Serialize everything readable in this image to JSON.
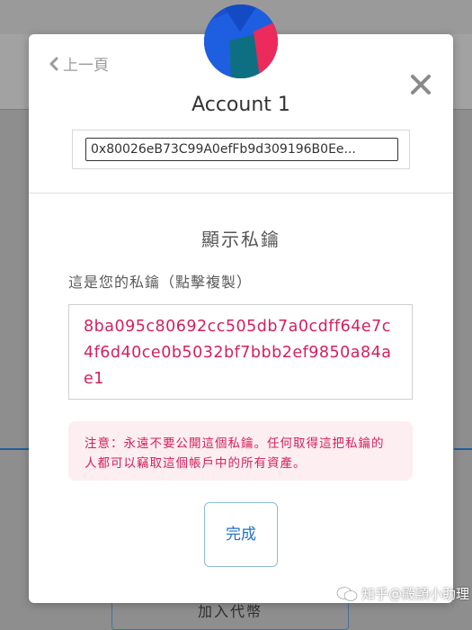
{
  "background": {
    "add_token_label": "加入代幣"
  },
  "modal": {
    "back_label": "上一頁",
    "account_name": "Account 1",
    "address": "0x80026eB73C99A0efFb9d309196B0Ee...",
    "section_title": "顯示私鑰",
    "key_label": "這是您的私鑰（點擊複製）",
    "private_key": "8ba095c80692cc505db7a0cdff64e7c4f6d40ce0b5032bf7bbb2ef9850a84ae1",
    "warning": "注意：永遠不要公開這個私鑰。任何取得這把私鑰的人都可以竊取這個帳戶中的所有資產。",
    "done_label": "完成"
  },
  "watermark": {
    "text": "知乎@殿頴小助理"
  },
  "colors": {
    "accent_red": "#d5205b",
    "button_blue": "#1f72c9",
    "warning_bg": "#fdeef1"
  },
  "icons": [
    "chevron-left-icon",
    "close-icon",
    "account-avatar-icon",
    "wechat-icon"
  ]
}
